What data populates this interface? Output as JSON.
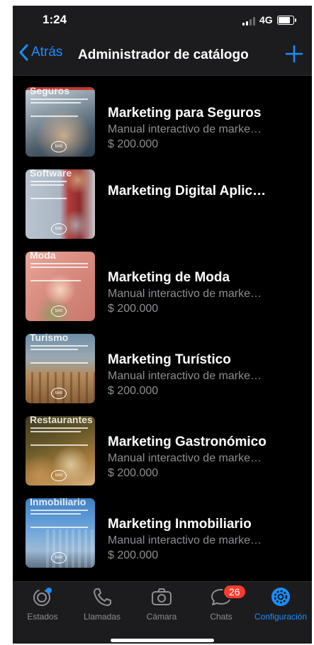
{
  "status": {
    "time": "1:24",
    "network": "4G"
  },
  "nav": {
    "back_label": "Atrás",
    "title": "Administrador de catálogo",
    "add_icon": "plus-icon"
  },
  "catalog": [
    {
      "thumb_title": "Seguros",
      "name": "Marketing para Seguros",
      "desc": "Manual interactivo de marke…",
      "price": "$ 200.000"
    },
    {
      "thumb_title": "Software",
      "name": "Marketing Digital Aplic…",
      "desc": "",
      "price": ""
    },
    {
      "thumb_title": "Moda",
      "name": "Marketing de Moda",
      "desc": "Manual interactivo de marke…",
      "price": "$ 200.000"
    },
    {
      "thumb_title": "Turismo",
      "name": "Marketing Turístico",
      "desc": "Manual interactivo de marke…",
      "price": "$ 200.000"
    },
    {
      "thumb_title": "Restaurantes",
      "name": "Marketing Gastronómico",
      "desc": "Manual interactivo de marke…",
      "price": "$ 200.000"
    },
    {
      "thumb_title": "Inmobiliario",
      "name": "Marketing Inmobiliario",
      "desc": "Manual interactivo de marke…",
      "price": "$ 200.000"
    }
  ],
  "thumb_logo": "bmt",
  "tabs": [
    {
      "label": "Estados",
      "icon": "status-ring-icon",
      "active": false
    },
    {
      "label": "Llamadas",
      "icon": "phone-icon",
      "active": false
    },
    {
      "label": "Cámara",
      "icon": "camera-icon",
      "active": false
    },
    {
      "label": "Chats",
      "icon": "chat-bubble-icon",
      "active": false,
      "badge": "26"
    },
    {
      "label": "Configuración",
      "icon": "gear-icon",
      "active": true
    }
  ],
  "colors": {
    "accent": "#1a8fff",
    "badge": "#ff3b30",
    "background": "#000000",
    "bar": "#1c1c1e"
  }
}
